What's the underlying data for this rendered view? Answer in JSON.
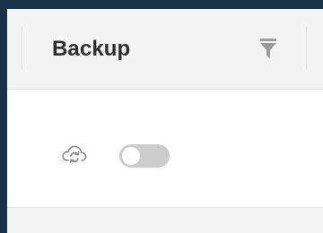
{
  "header": {
    "title": "Backup",
    "filter_icon": "filter-icon"
  },
  "backup_row": {
    "icon": "cloud-sync-icon",
    "toggle": {
      "state": "off"
    }
  },
  "colors": {
    "window_background": "#17324a",
    "header_background": "#f4f4f4",
    "title_text": "#2f2f2f",
    "filter_icon": "#9b9b9b",
    "toggle_track_off": "#cccccc",
    "toggle_knob": "#ffffff",
    "cloud_icon": "#8a8a8a"
  }
}
